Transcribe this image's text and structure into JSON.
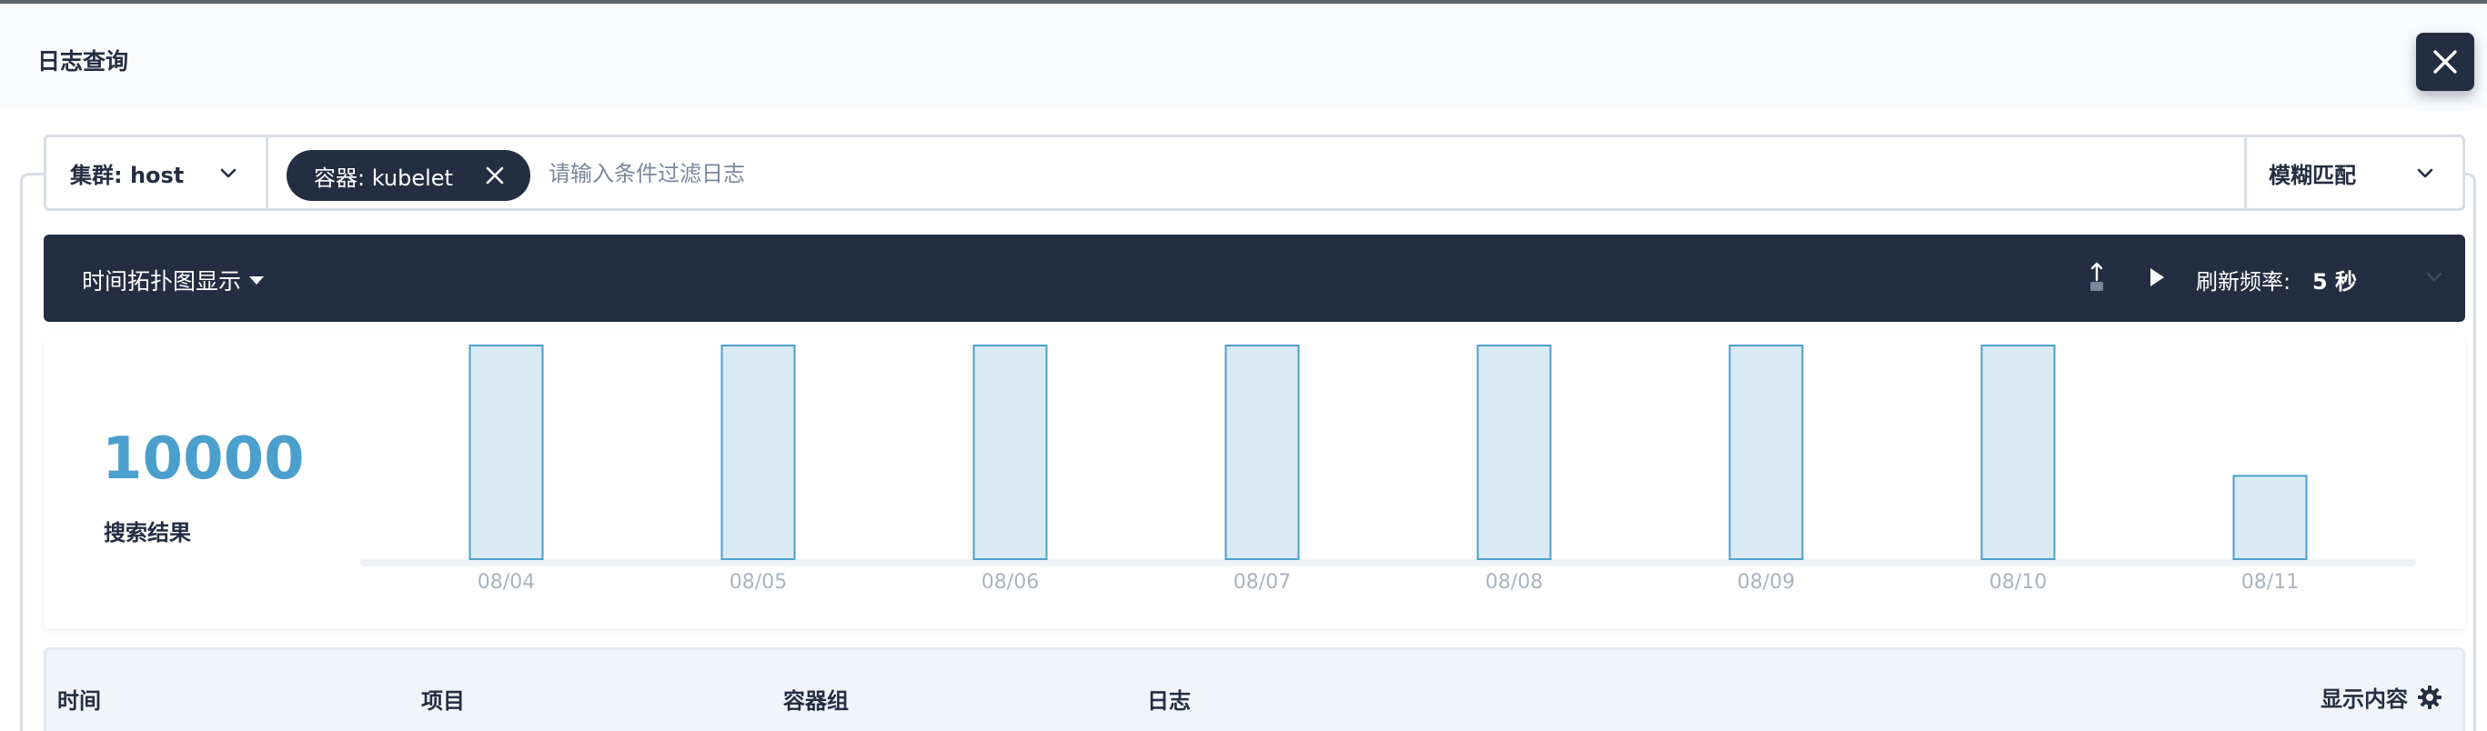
{
  "header": {
    "title": "日志查询"
  },
  "search": {
    "cluster_label": "集群: host",
    "tag_label": "容器: kubelet",
    "placeholder": "请输入条件过滤日志",
    "match_mode": "模糊匹配"
  },
  "toolbar": {
    "view_toggle": "时间拓扑图显示",
    "refresh_label": "刷新频率:",
    "refresh_value": "5 秒"
  },
  "summary": {
    "count": "10000",
    "count_label": "搜索结果"
  },
  "chart_data": {
    "type": "bar",
    "categories": [
      "08/04",
      "08/05",
      "08/06",
      "08/07",
      "08/08",
      "08/09",
      "08/10",
      "08/11"
    ],
    "values": [
      1,
      1,
      1,
      1,
      1,
      1,
      1,
      0.39
    ],
    "ylim": [
      0,
      1
    ],
    "grid": false,
    "colors": {
      "bar_fill": "#d9eaf5",
      "bar_stroke": "#4b9fcc",
      "axis": "#eef2f6",
      "tick": "#abb4be"
    }
  },
  "table": {
    "columns": [
      "时间",
      "项目",
      "容器组",
      "日志"
    ],
    "settings_label": "显示内容"
  },
  "icons": {
    "close": "close-icon",
    "chevron": "chevron-down-icon",
    "caret": "caret-down-icon",
    "export": "export-icon",
    "play": "play-icon",
    "gear": "gear-icon"
  }
}
